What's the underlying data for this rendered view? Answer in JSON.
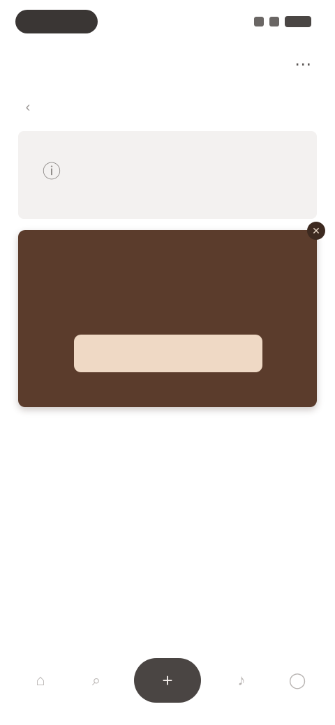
{
  "header": {
    "title": "",
    "action_icon": "more-icon"
  },
  "subrow": {
    "label": "",
    "right_text": ""
  },
  "info_card": {
    "line1": "",
    "line2": "",
    "icon": "info-icon"
  },
  "banner": {
    "text": "",
    "subtext": "",
    "button_label": "",
    "background": "#5b3c2c",
    "button_color": "#efd9c5",
    "corner_icon": "close-icon"
  },
  "bottom_nav": {
    "items": [
      {
        "icon": "home-icon"
      },
      {
        "icon": "search-icon"
      },
      {
        "icon": "add-icon"
      },
      {
        "icon": "bell-icon"
      },
      {
        "icon": "profile-icon"
      }
    ]
  }
}
